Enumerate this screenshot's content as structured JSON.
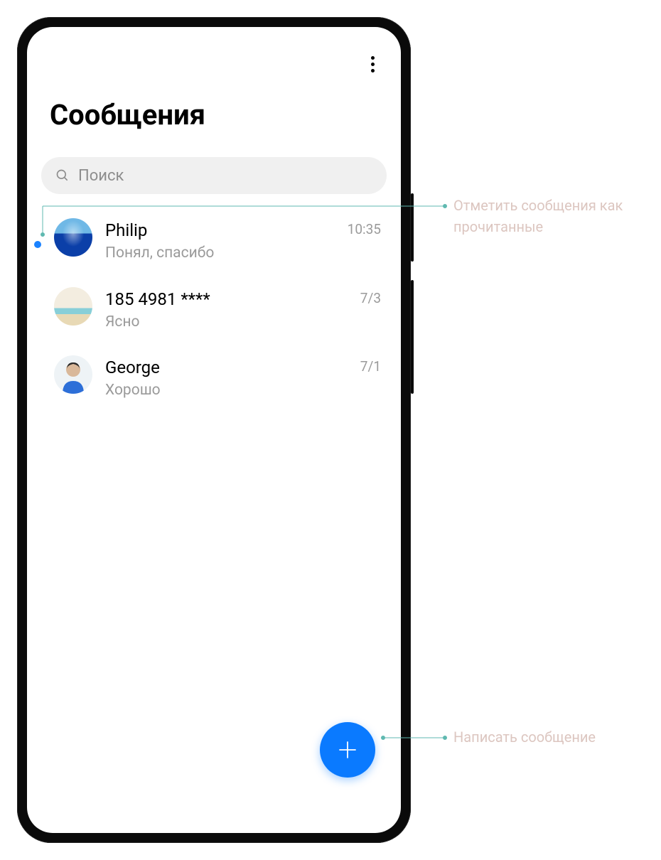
{
  "app": {
    "title": "Сообщения",
    "search_placeholder": "Поиск"
  },
  "conversations": [
    {
      "name": "Philip",
      "preview": "Понял, спасибо",
      "time": "10:35",
      "unread": true,
      "avatar": "ocean"
    },
    {
      "name": "185 4981 ****",
      "preview": "Ясно",
      "time": "7/3",
      "unread": false,
      "avatar": "beach"
    },
    {
      "name": "George",
      "preview": "Хорошо",
      "time": "7/1",
      "unread": false,
      "avatar": "person"
    }
  ],
  "callouts": {
    "mark_read": "Отметить сообщения как прочитанные",
    "compose": "Написать сообщение"
  },
  "colors": {
    "accent": "#0a7aff",
    "callout_text": "#dcc6c0",
    "leader": "#5fb9b0"
  }
}
